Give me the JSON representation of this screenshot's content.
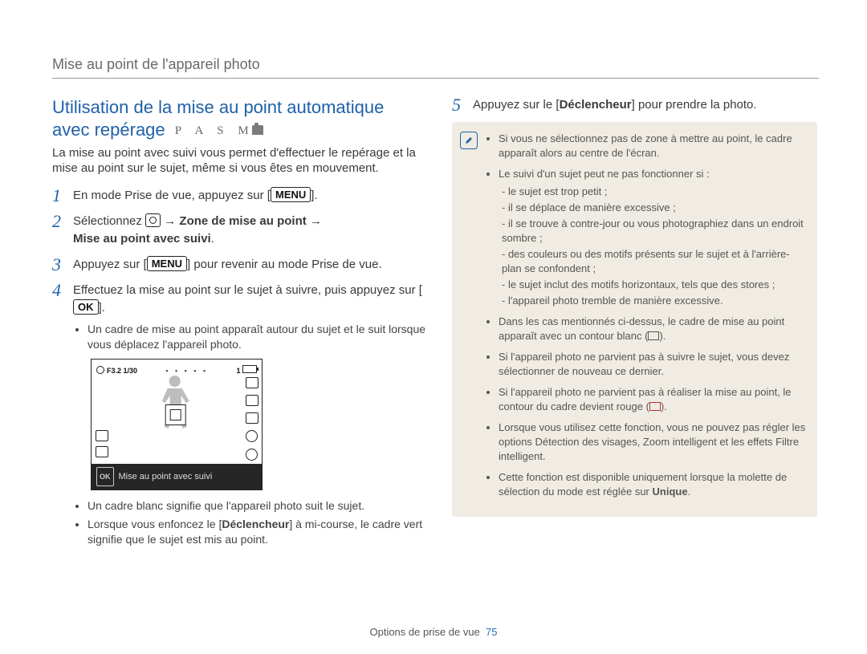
{
  "breadcrumb": "Mise au point de l'appareil photo",
  "section_title_l1": "Utilisation de la mise au point automatique",
  "section_title_l2": "avec repérage",
  "modes_letters": "P A S M",
  "intro": "La mise au point avec suivi vous permet d'effectuer le repérage et la mise au point sur le sujet, même si vous êtes en mouvement.",
  "steps": {
    "s1_pre": "En mode Prise de vue, appuyez sur [",
    "s1_kbd": "MENU",
    "s1_post": "].",
    "s2_pre": "Sélectionnez ",
    "s2_mid": " → ",
    "s2_b1": "Zone de mise au point",
    "s2_b2": "Mise au point avec suivi",
    "s2_end": ".",
    "s3_pre": "Appuyez sur [",
    "s3_kbd": "MENU",
    "s3_post": "] pour revenir au mode Prise de vue.",
    "s4_pre": "Effectuez la mise au point sur le sujet à suivre, puis appuyez sur [",
    "s4_kbd": "OK",
    "s4_post": "].",
    "s5_pre": "Appuyez sur le [",
    "s5_b": "Déclencheur",
    "s5_post": "] pour prendre la photo."
  },
  "camera": {
    "exposure": "F3.2  1/30",
    "count": "1",
    "caption_ok": "OK",
    "caption": "Mise au point avec suivi"
  },
  "left_sub": {
    "b1": "Un cadre de mise au point apparaît autour du sujet et le suit lorsque vous déplacez l'appareil photo.",
    "b2": "Un cadre blanc signifie que l'appareil photo suit le sujet.",
    "b3_pre": "Lorsque vous enfoncez le [",
    "b3_b": "Déclencheur",
    "b3_post": "] à mi-course, le cadre vert signifie que le sujet est mis au point."
  },
  "info": {
    "i1": "Si vous ne sélectionnez pas de zone à mettre au point, le cadre apparaît alors au centre de l'écran.",
    "i2": "Le suivi d'un sujet peut ne pas fonctionner si :",
    "i2s": {
      "a": "le sujet est trop petit ;",
      "b": "il se déplace de manière excessive ;",
      "c": "il se trouve à contre-jour ou vous photographiez dans un endroit sombre ;",
      "d": "des couleurs ou des motifs présents sur le sujet et à l'arrière-plan se confondent ;",
      "e": "le sujet inclut des motifs horizontaux, tels que des stores ;",
      "f": "l'appareil photo tremble de manière excessive."
    },
    "i3_pre": "Dans les cas mentionnés ci-dessus, le cadre de mise au point apparaît avec un contour blanc (",
    "i3_post": ").",
    "i4": "Si l'appareil photo ne parvient pas à suivre le sujet, vous devez sélectionner de nouveau ce dernier.",
    "i5_pre": "Si l'appareil photo ne parvient pas à réaliser la mise au point, le contour du cadre devient rouge (",
    "i5_post": ").",
    "i6": "Lorsque vous utilisez cette fonction, vous ne pouvez pas régler les options Détection des visages, Zoom intelligent et les effets Filtre intelligent.",
    "i7_pre": "Cette fonction est disponible uniquement lorsque la molette de sélection du mode est réglée sur ",
    "i7_b": "Unique",
    "i7_post": "."
  },
  "footer": {
    "label": "Options de prise de vue",
    "page": "75"
  }
}
